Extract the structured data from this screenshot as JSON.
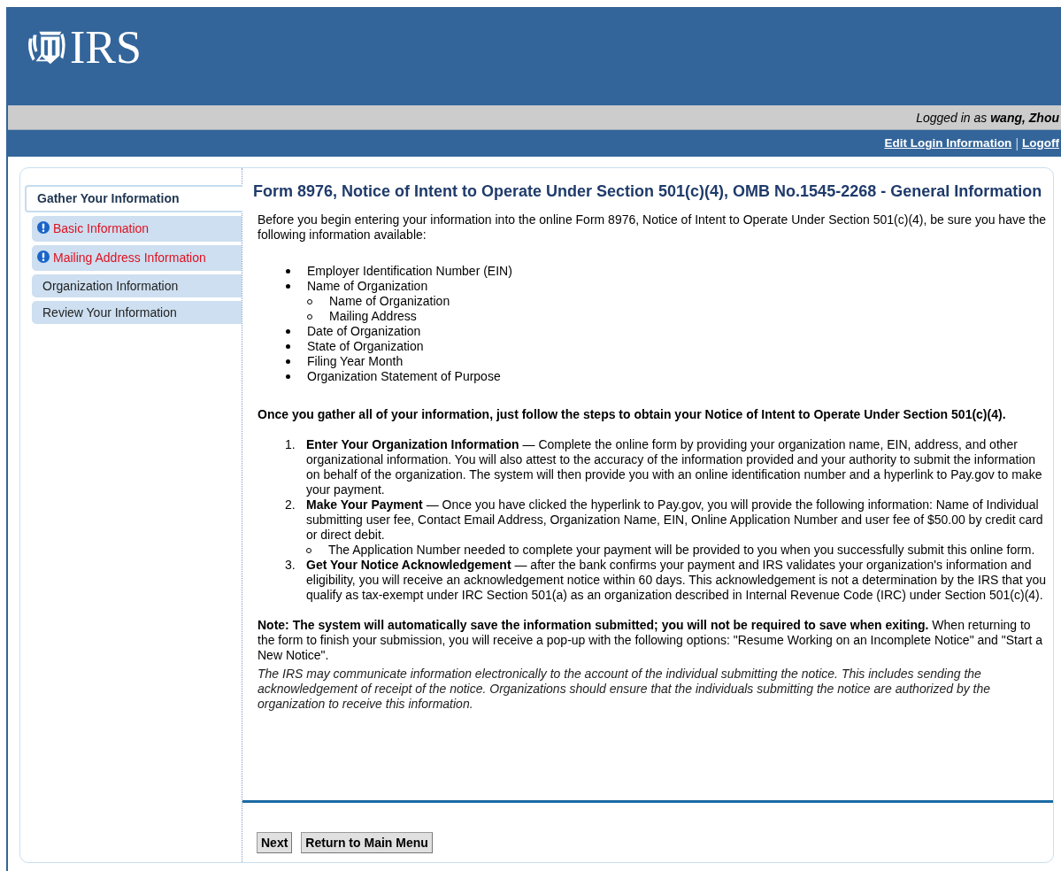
{
  "header": {
    "logo_text": "IRS",
    "login_status": "Logged in as **wang, Zhou**",
    "links": [
      {
        "label": "Edit Login Information"
      },
      {
        "label": "Logoff"
      }
    ],
    "link_separator": "|"
  },
  "sidebar": {
    "heading": {
      "label": "Gather Your Information",
      "selected": true
    },
    "items": [
      {
        "label": "Basic Information",
        "incomplete": true
      },
      {
        "label": "Mailing Address Information",
        "incomplete": true
      },
      {
        "label": "Organization Information",
        "incomplete": false
      },
      {
        "label": "Review Your Information",
        "incomplete": false
      }
    ]
  },
  "main": {
    "title": "Form 8976, Notice of Intent to Operate Under Section 501(c)(4), OMB No.1545-2268 - General Information",
    "intro": "Before you begin entering your information into the online Form 8976, Notice of Intent to Operate Under Section 501(c)(4), be sure you have the following information available:",
    "checklist": [
      {
        "text": "Employer Identification Number (EIN)"
      },
      {
        "text": "Name of Organization",
        "children": [
          {
            "text": "Name of Organization"
          },
          {
            "text": "Mailing Address"
          }
        ]
      },
      {
        "text": "Date of Organization"
      },
      {
        "text": "State of Organization"
      },
      {
        "text": "Filing Year Month"
      },
      {
        "text": "Organization Statement of Purpose"
      }
    ],
    "steps_intro": "Once you gather all of your information, just follow the steps to obtain your Notice of Intent to Operate Under Section 501(c)(4).",
    "steps": [
      {
        "number": "1.",
        "text": "**Enter Your Organization Information** — Complete the online form by providing your organization name, EIN, address, and other organizational information. You will also attest to the accuracy of the information provided and your authority to submit the information on behalf of the organization. The system will then provide you with an online identification number and a hyperlink to Pay.gov to make your payment."
      },
      {
        "number": "2.",
        "text": "**Make Your Payment** — Once you have clicked the hyperlink to Pay.gov, you will provide the following information: Name of Individual submitting user fee, Contact Email Address, Organization Name, EIN, Online Application Number and user fee of $50.00 by credit card or direct debit.",
        "children": [
          {
            "text": "The Application Number needed to complete your payment will be provided to you when you successfully submit this online form."
          }
        ]
      },
      {
        "number": "3.",
        "text": "**Get Your Notice Acknowledgement** — after the bank confirms your payment and IRS validates your organization's information and eligibility, you will receive an acknowledgement notice within 60 days. This acknowledgement is not a determination by the IRS that you qualify as tax-exempt under IRC Section 501(a) as an organization described in Internal Revenue Code (IRC) under Section 501(c)(4)."
      }
    ],
    "note": "**Note: The system will automatically save the information submitted; you will not be required to save when exiting.** When returning to the form to finish your submission, you will receive a pop-up with the following options: \"Resume Working on an Incomplete Notice\" and \"Start a New Notice\".",
    "disclaimer": "The IRS may communicate information electronically to the account of the individual submitting the notice. This includes sending the acknowledgement of receipt of the notice. Organizations should ensure that the individuals submitting the notice are authorized by the organization to receive this information.",
    "buttons": [
      {
        "label": "Next"
      },
      {
        "label": "Return to Main Menu"
      }
    ]
  }
}
